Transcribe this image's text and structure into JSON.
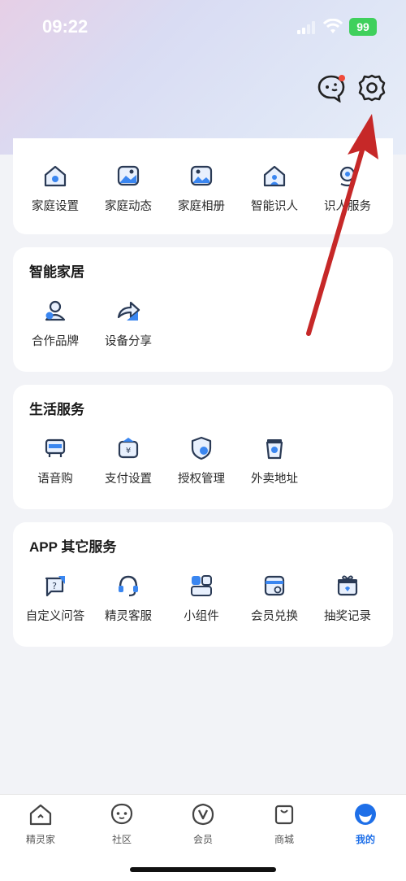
{
  "status": {
    "time": "09:22",
    "battery": "99"
  },
  "header": {
    "chat_icon": "chat-bubble-icon",
    "settings_icon": "gear-icon"
  },
  "card_top": {
    "items": [
      {
        "label": "家庭设置",
        "icon": "home-gear-icon"
      },
      {
        "label": "家庭动态",
        "icon": "photo-icon"
      },
      {
        "label": "家庭相册",
        "icon": "album-icon"
      },
      {
        "label": "智能识人",
        "icon": "home-person-icon"
      },
      {
        "label": "识人服务",
        "icon": "face-scan-icon"
      }
    ]
  },
  "smart_home": {
    "title": "智能家居",
    "items": [
      {
        "label": "合作品牌",
        "icon": "partner-icon"
      },
      {
        "label": "设备分享",
        "icon": "share-icon"
      }
    ]
  },
  "life_services": {
    "title": "生活服务",
    "items": [
      {
        "label": "语音购",
        "icon": "voice-shop-icon"
      },
      {
        "label": "支付设置",
        "icon": "payment-icon"
      },
      {
        "label": "授权管理",
        "icon": "shield-icon"
      },
      {
        "label": "外卖地址",
        "icon": "takeout-icon"
      }
    ]
  },
  "other_services": {
    "title": "APP 其它服务",
    "items": [
      {
        "label": "自定义问答",
        "icon": "qa-icon"
      },
      {
        "label": "精灵客服",
        "icon": "headset-icon"
      },
      {
        "label": "小组件",
        "icon": "widget-icon"
      },
      {
        "label": "会员兑换",
        "icon": "redeem-icon"
      },
      {
        "label": "抽奖记录",
        "icon": "gift-icon"
      }
    ]
  },
  "tabbar": {
    "tabs": [
      {
        "label": "精灵家",
        "icon": "home-icon"
      },
      {
        "label": "社区",
        "icon": "community-icon"
      },
      {
        "label": "会员",
        "icon": "vip-icon"
      },
      {
        "label": "商城",
        "icon": "shop-bag-icon"
      },
      {
        "label": "我的",
        "icon": "profile-icon",
        "active": true
      }
    ]
  },
  "colors": {
    "accent": "#1e6fe8",
    "arrow": "#c62828",
    "icon_blue": "#3a86f0"
  }
}
